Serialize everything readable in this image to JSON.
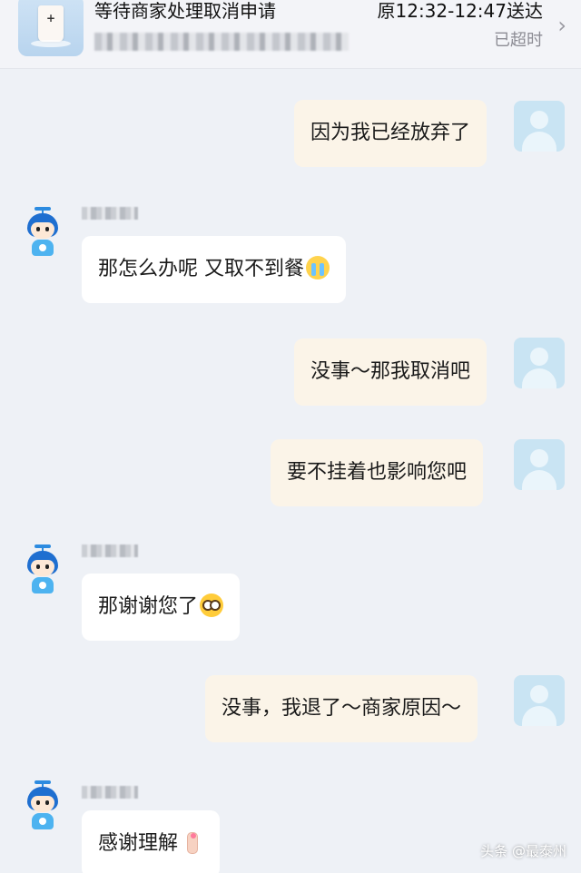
{
  "order": {
    "status": "等待商家处理取消申请",
    "time": "原12:32-12:47送达",
    "overtime": "已超时",
    "product_image": "milk-tea-cup",
    "chevron_icon": "chevron-right-icon"
  },
  "messages": [
    {
      "side": "me",
      "text": "因为我已经放弃了"
    },
    {
      "side": "them",
      "text": "那怎么办呢 又取不到餐",
      "emoji": "crying-face-emoji"
    },
    {
      "side": "me",
      "text": "没事～那我取消吧"
    },
    {
      "side": "me",
      "text": "要不挂着也影响您吧"
    },
    {
      "side": "them",
      "text": "那谢谢您了",
      "emoji": "pleading-face-emoji"
    },
    {
      "side": "me",
      "text": "没事，我退了～商家原因～"
    },
    {
      "side": "them",
      "text": "感谢理解",
      "emoji": "finger-heart-emoji"
    }
  ],
  "watermark": "头条 @最泰州",
  "colors": {
    "page_bg": "#eef1f6",
    "my_bubble": "#fbf4e8",
    "their_bubble": "#ffffff",
    "overtime_text": "#8c8c94"
  }
}
